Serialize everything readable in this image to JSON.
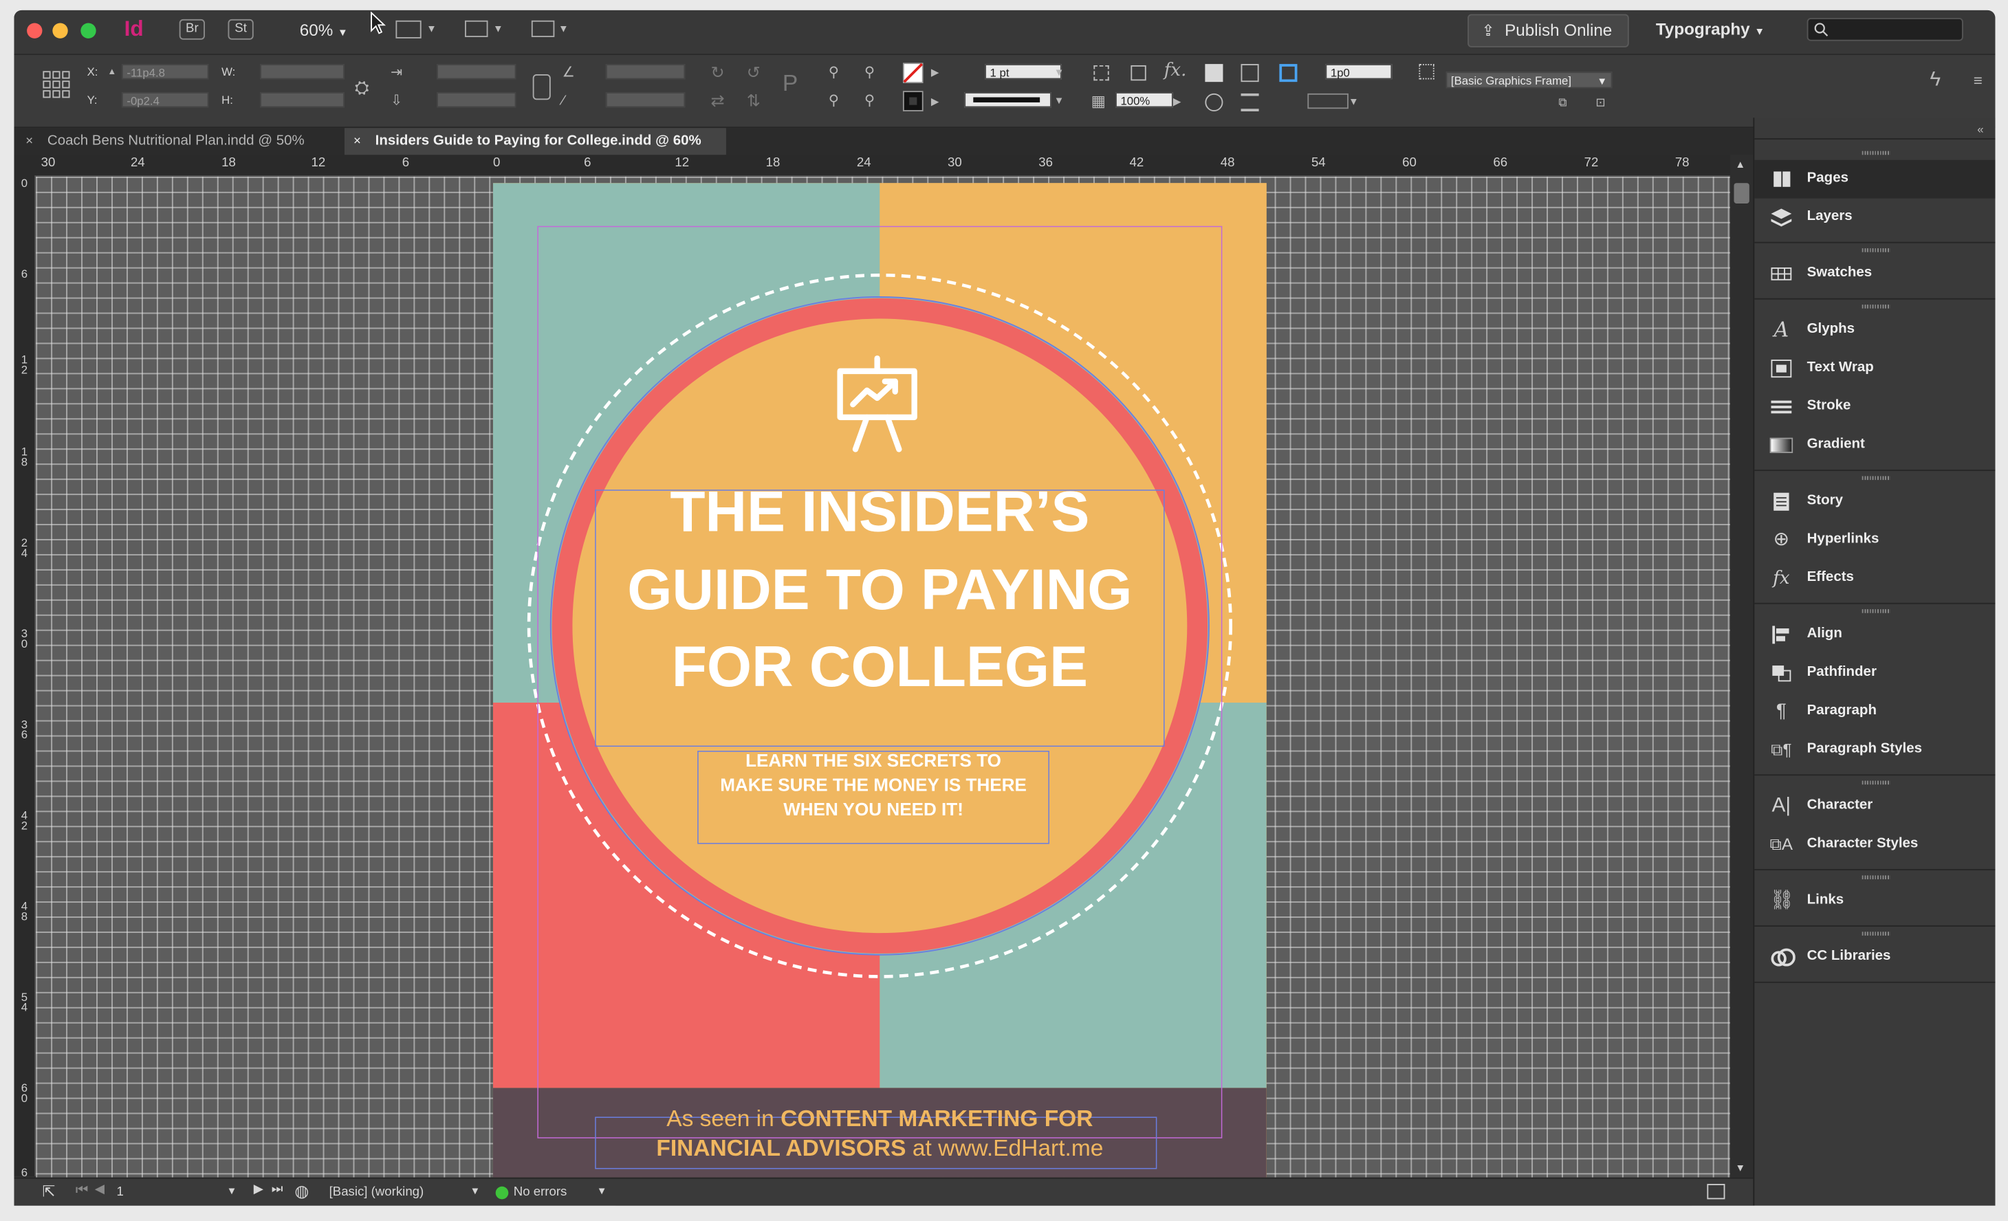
{
  "app": {
    "logo": "Id",
    "bridge_btn": "Br",
    "stock_btn": "St",
    "zoom": "60%",
    "publish_label": "Publish Online",
    "workspace": "Typography"
  },
  "control": {
    "x_label": "X:",
    "y_label": "Y:",
    "w_label": "W:",
    "h_label": "H:",
    "x_value": "-11p4.8",
    "y_value": "-0p2.4",
    "stroke_weight": "1 pt",
    "fitting_value": "1p0",
    "opacity": "100%",
    "frame_style": "[Basic Graphics Frame]"
  },
  "tabs": [
    {
      "label": "Coach Bens Nutritional Plan.indd @ 50%"
    },
    {
      "label": "Insiders Guide to Paying for College.indd @ 60%"
    }
  ],
  "rulers": {
    "h": [
      "30",
      "24",
      "18",
      "12",
      "6",
      "0",
      "6",
      "12",
      "18",
      "24",
      "30",
      "36",
      "42",
      "48",
      "54",
      "60",
      "66",
      "72",
      "78"
    ],
    "v": [
      "0",
      "6",
      "1 2",
      "1 8",
      "2 4",
      "3 0",
      "3 6",
      "4 2",
      "4 8",
      "5 4",
      "6 0",
      "6"
    ]
  },
  "poster": {
    "title_lines": [
      "THE INSIDER’S",
      "GUIDE TO PAYING",
      "FOR COLLEGE"
    ],
    "subtitle_lines": [
      "LEARN THE SIX SECRETS TO",
      "MAKE SURE THE MONEY IS THERE",
      "WHEN YOU NEED IT!"
    ],
    "footer": {
      "l1_a": "As seen in ",
      "l1_b": "CONTENT MARKETING FOR",
      "l2_a": "FINANCIAL ADVISORS",
      "l2_b": " at www.EdHart.me"
    },
    "colors": {
      "teal": "#8fbdb2",
      "orange": "#f0b760",
      "coral": "#f06563",
      "footer_bg": "#5c4a52"
    }
  },
  "status": {
    "page": "1",
    "style": "[Basic] (working)",
    "preflight": "No errors"
  },
  "panels": [
    {
      "label": "Pages",
      "icon": "pages-icon"
    },
    {
      "label": "Layers",
      "icon": "layers-icon"
    },
    {
      "label": "Swatches",
      "icon": "swatches-icon"
    },
    {
      "label": "Glyphs",
      "icon": "glyphs-icon"
    },
    {
      "label": "Text Wrap",
      "icon": "text-wrap-icon"
    },
    {
      "label": "Stroke",
      "icon": "stroke-icon"
    },
    {
      "label": "Gradient",
      "icon": "gradient-icon"
    },
    {
      "label": "Story",
      "icon": "story-icon"
    },
    {
      "label": "Hyperlinks",
      "icon": "hyperlinks-icon"
    },
    {
      "label": "Effects",
      "icon": "effects-icon"
    },
    {
      "label": "Align",
      "icon": "align-icon"
    },
    {
      "label": "Pathfinder",
      "icon": "pathfinder-icon"
    },
    {
      "label": "Paragraph",
      "icon": "paragraph-icon"
    },
    {
      "label": "Paragraph Styles",
      "icon": "paragraph-styles-icon"
    },
    {
      "label": "Character",
      "icon": "character-icon"
    },
    {
      "label": "Character Styles",
      "icon": "character-styles-icon"
    },
    {
      "label": "Links",
      "icon": "links-icon"
    },
    {
      "label": "CC Libraries",
      "icon": "cc-libraries-icon"
    }
  ]
}
